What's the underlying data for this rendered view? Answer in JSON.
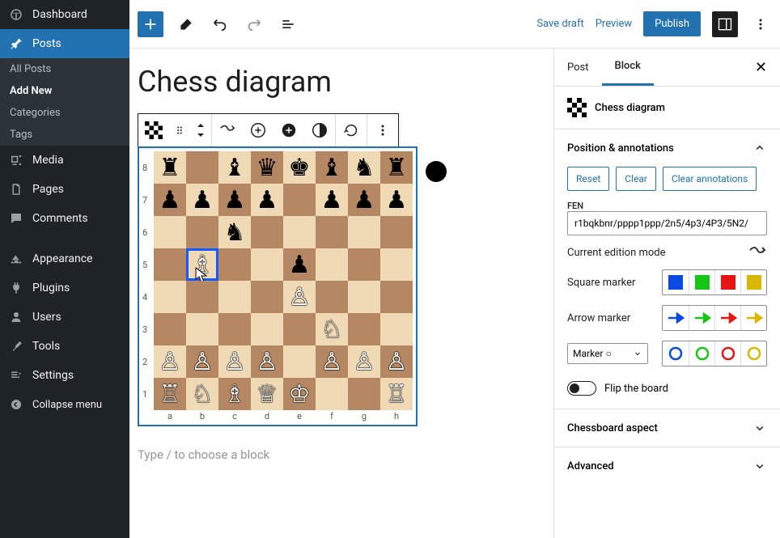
{
  "admin_menu": {
    "dashboard": "Dashboard",
    "posts": "Posts",
    "media": "Media",
    "pages": "Pages",
    "comments": "Comments",
    "appearance": "Appearance",
    "plugins": "Plugins",
    "users": "Users",
    "tools": "Tools",
    "settings": "Settings",
    "collapse": "Collapse menu"
  },
  "posts_submenu": {
    "all": "All Posts",
    "add_new": "Add New",
    "categories": "Categories",
    "tags": "Tags"
  },
  "toolbar": {
    "save_draft": "Save draft",
    "preview": "Preview",
    "publish": "Publish"
  },
  "post_title": "Chess diagram",
  "block_placeholder": "Type / to choose a block",
  "inspector": {
    "tab_post": "Post",
    "tab_block": "Block",
    "block_name": "Chess diagram",
    "section_position": "Position & annotations",
    "section_aspect": "Chessboard aspect",
    "section_advanced": "Advanced",
    "reset": "Reset",
    "clear": "Clear",
    "clear_annotations": "Clear annotations",
    "fen_label": "FEN",
    "fen_value": "r1bqkbnr/pppp1ppp/2n5/4p3/4P3/5N2/",
    "edition_mode": "Current edition mode",
    "square_marker": "Square marker",
    "arrow_marker": "Arrow marker",
    "marker_o": "Marker ○",
    "flip_board": "Flip the board"
  },
  "colors": {
    "marker_blue": "#0b4ae0",
    "marker_green": "#19c419",
    "marker_red": "#e81313",
    "marker_yellow": "#d9b600"
  },
  "board": {
    "ranks": [
      "8",
      "7",
      "6",
      "5",
      "4",
      "3",
      "2",
      "1"
    ],
    "files": [
      "a",
      "b",
      "c",
      "d",
      "e",
      "f",
      "g",
      "h"
    ],
    "position": [
      [
        "br",
        "",
        "bb",
        "bq",
        "bk",
        "bb",
        "bn",
        "br"
      ],
      [
        "bp",
        "bp",
        "bp",
        "bp",
        "",
        "bp",
        "bp",
        "bp"
      ],
      [
        "",
        "",
        "bn",
        "",
        "",
        "",
        "",
        ""
      ],
      [
        "",
        "wb",
        "",
        "",
        "bp",
        "",
        "",
        ""
      ],
      [
        "",
        "",
        "",
        "",
        "wp",
        "",
        "",
        ""
      ],
      [
        "",
        "",
        "",
        "",
        "",
        "wn",
        "",
        ""
      ],
      [
        "wp",
        "wp",
        "wp",
        "wp",
        "",
        "wp",
        "wp",
        "wp"
      ],
      [
        "wr",
        "wn",
        "wb",
        "wq",
        "wk",
        "",
        "",
        "wr"
      ]
    ],
    "selected": "b5"
  }
}
